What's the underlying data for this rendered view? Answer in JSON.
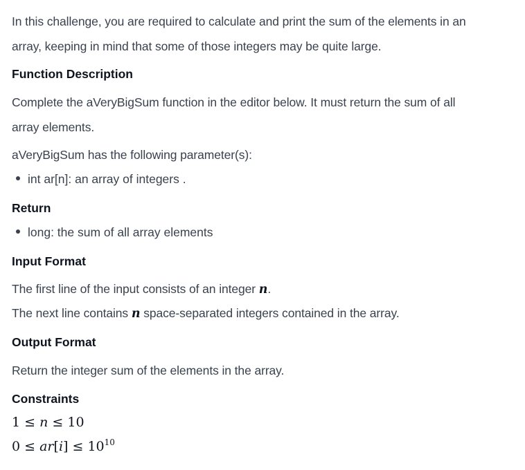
{
  "intro": {
    "line1": "In this challenge, you are required to calculate and print the sum of the elements in an",
    "line2": "array, keeping in mind that some of those integers may be quite large."
  },
  "function_description": {
    "heading": "Function Description",
    "line1": "Complete the aVeryBigSum function in the editor below. It must return the sum of all",
    "line2": "array elements.",
    "params_intro": "aVeryBigSum has the following parameter(s):",
    "params": [
      "int ar[n]: an array of integers ."
    ]
  },
  "return": {
    "heading": "Return",
    "items": [
      "long: the sum of all array elements"
    ]
  },
  "input_format": {
    "heading": "Input Format",
    "line1_before": "The first line of the input consists of an integer ",
    "line1_var": "n",
    "line1_after": ".",
    "line2_before": "The next line contains ",
    "line2_var": "n",
    "line2_after": " space-separated integers contained in the array."
  },
  "output_format": {
    "heading": "Output Format",
    "line1": "Return the integer sum of the elements in the array."
  },
  "constraints": {
    "heading": "Constraints",
    "c1": {
      "lo": "1",
      "op1": "≤",
      "var": "n",
      "op2": "≤",
      "hi": "10"
    },
    "c2": {
      "lo": "0",
      "op1": "≤",
      "var": "ar",
      "lb": "[",
      "idx": "i",
      "rb": "]",
      "op2": "≤",
      "base": "10",
      "exp": "10"
    }
  }
}
